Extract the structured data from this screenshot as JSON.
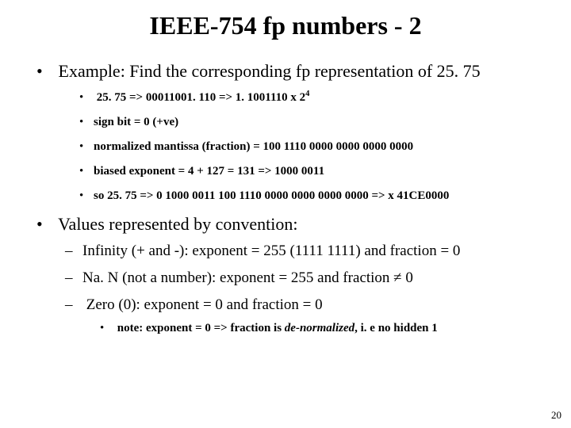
{
  "title": "IEEE-754 fp numbers - 2",
  "b1": "Example: Find the corresponding fp representation of 25. 75",
  "s1": "25. 75 => 00011001. 110 => 1. 1001110 x 2",
  "s1_sup": "4",
  "s2": "sign bit = 0 (+ve)",
  "s3": "normalized mantissa (fraction) = 100 1110 0000 0000 0000 0000",
  "s4": "biased exponent = 4 + 127 = 131 => 1000 0011",
  "s5": "so 25. 75 => 0 1000 0011 100 1110 0000 0000 0000 0000 => x 41CE0000",
  "b2": "Values represented by convention:",
  "d1": "Infinity (+ and -): exponent = 255 (1111 1111) and fraction = 0",
  "d2": "Na. N (not a number): exponent = 255 and fraction ≠ 0",
  "d3": "Zero (0): exponent = 0 and fraction = 0",
  "n1a": "note: exponent = 0  =>  fraction is ",
  "n1b": "de-normalized",
  "n1c": ", i. e no hidden 1",
  "page": "20"
}
